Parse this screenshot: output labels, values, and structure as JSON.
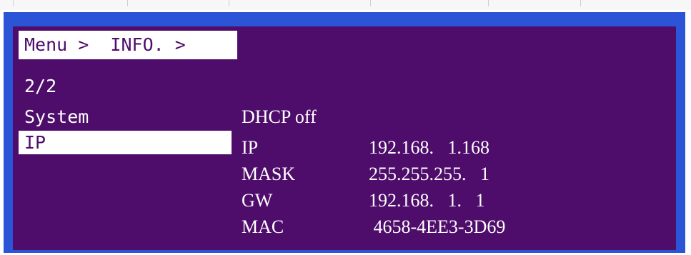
{
  "breadcrumb": {
    "text": "Menu >  INFO. >"
  },
  "page_indicator": "2/2",
  "menu": {
    "items": [
      {
        "label": "System",
        "selected": false
      },
      {
        "label": "IP",
        "selected": true
      }
    ]
  },
  "info": {
    "dhcp_label": "DHCP off",
    "rows": [
      {
        "label": "IP",
        "value": "192.168.   1.168"
      },
      {
        "label": "MASK",
        "value": "255.255.255.   1"
      },
      {
        "label": "GW",
        "value": "192.168.   1.   1"
      },
      {
        "label": "MAC",
        "value": " 4658-4EE3-3D69"
      }
    ]
  },
  "colors": {
    "screen_background": "#4f0d6b",
    "frame_border": "#2b54d6",
    "text": "#ffffff",
    "highlight_background": "#ffffff"
  }
}
